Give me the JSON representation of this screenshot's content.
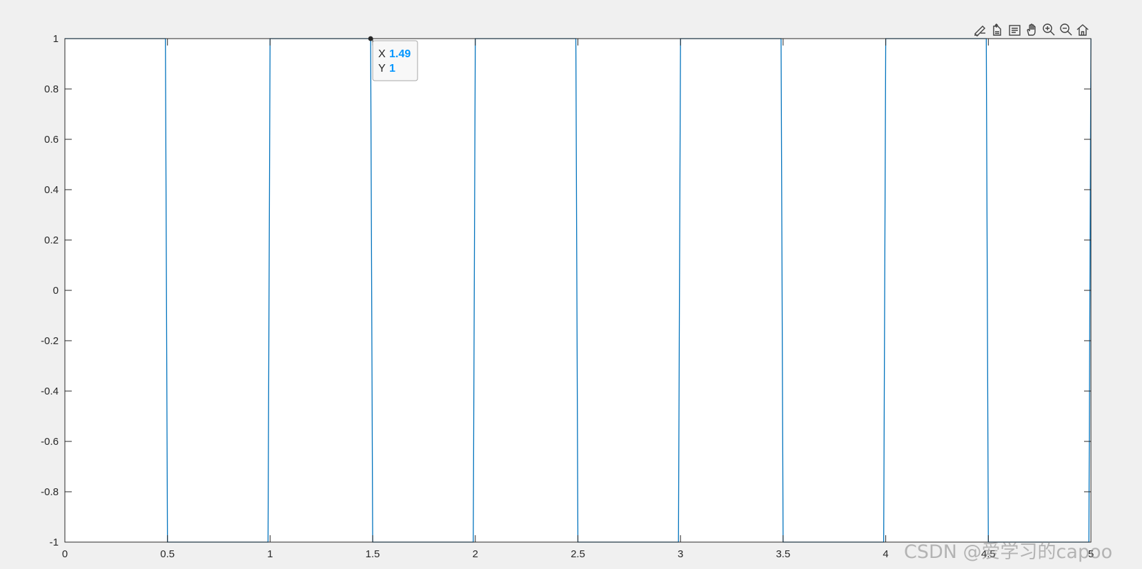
{
  "chart_data": {
    "type": "line",
    "title": "",
    "xlabel": "",
    "ylabel": "",
    "xlim": [
      0,
      5
    ],
    "ylim": [
      -1,
      1
    ],
    "x_ticks": [
      "0",
      "0.5",
      "1",
      "1.5",
      "2",
      "2.5",
      "3",
      "3.5",
      "4",
      "4.5",
      "5"
    ],
    "y_ticks": [
      "1",
      "0.8",
      "0.6",
      "0.4",
      "0.2",
      "0",
      "-0.2",
      "-0.4",
      "-0.6",
      "-0.8",
      "-1"
    ],
    "grid": false,
    "series": [
      {
        "color": "#0072BD",
        "x": [
          0,
          0.49,
          0.5,
          0.99,
          1.0,
          1.49,
          1.5,
          1.99,
          2.0,
          2.49,
          2.5,
          2.99,
          3.0,
          3.49,
          3.5,
          3.99,
          4.0,
          4.49,
          4.5,
          4.99,
          5.0
        ],
        "y": [
          1,
          1,
          -1,
          -1,
          1,
          1,
          -1,
          -1,
          1,
          1,
          -1,
          -1,
          1,
          1,
          -1,
          -1,
          1,
          1,
          -1,
          -1,
          1
        ]
      }
    ],
    "datatip": {
      "x_label": "X",
      "x_value": "1.49",
      "y_label": "Y",
      "y_value": "1",
      "x": 1.49,
      "y": 1
    }
  },
  "toolbar": {
    "icons": [
      "brush-icon",
      "export-icon",
      "datatip-icon",
      "pan-hand-icon",
      "zoom-in-icon",
      "zoom-out-icon",
      "home-icon"
    ]
  },
  "watermark": "CSDN @爱学习的capoo"
}
